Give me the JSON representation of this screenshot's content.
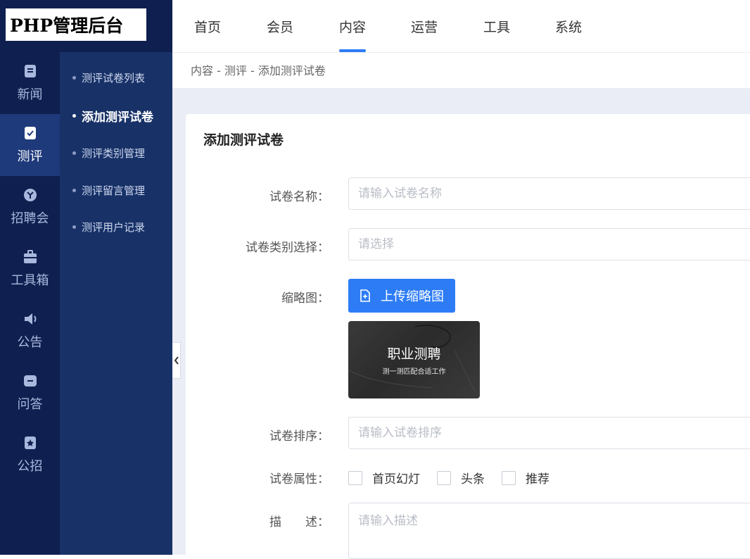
{
  "logo": "PHP管理后台",
  "rail": [
    {
      "label": "新闻",
      "icon": "news-icon"
    },
    {
      "label": "测评",
      "icon": "evaluation-icon"
    },
    {
      "label": "招聘会",
      "icon": "job-fair-icon"
    },
    {
      "label": "工具箱",
      "icon": "toolbox-icon"
    },
    {
      "label": "公告",
      "icon": "announcement-icon"
    },
    {
      "label": "问答",
      "icon": "qa-icon"
    },
    {
      "label": "公招",
      "icon": "public-recruit-icon"
    }
  ],
  "subnav": [
    {
      "label": "测评试卷列表"
    },
    {
      "label": "添加测评试卷"
    },
    {
      "label": "测评类别管理"
    },
    {
      "label": "测评留言管理"
    },
    {
      "label": "测评用户记录"
    }
  ],
  "topnav": [
    {
      "label": "首页"
    },
    {
      "label": "会员"
    },
    {
      "label": "内容"
    },
    {
      "label": "运营"
    },
    {
      "label": "工具"
    },
    {
      "label": "系统"
    }
  ],
  "breadcrumb": "内容 - 测评 - 添加测评试卷",
  "form": {
    "title": "添加测评试卷",
    "name_label": "试卷名称：",
    "name_placeholder": "请输入试卷名称",
    "category_label": "试卷类别选择：",
    "category_placeholder": "请选择",
    "thumb_label": "缩略图：",
    "upload_label": "上传缩略图",
    "thumb_title": "职业测聘",
    "thumb_subtitle": "测一测匹配合适工作",
    "sort_label": "试卷排序：",
    "sort_placeholder": "请输入试卷排序",
    "attr_label": "试卷属性：",
    "attrs": [
      "首页幻灯",
      "头条",
      "推荐"
    ],
    "desc_label": "描　　述：",
    "desc_placeholder": "请输入描述"
  },
  "colors": {
    "rail_bg": "#0f2050",
    "subnav_bg": "#183268",
    "accent": "#2d7cf6"
  }
}
